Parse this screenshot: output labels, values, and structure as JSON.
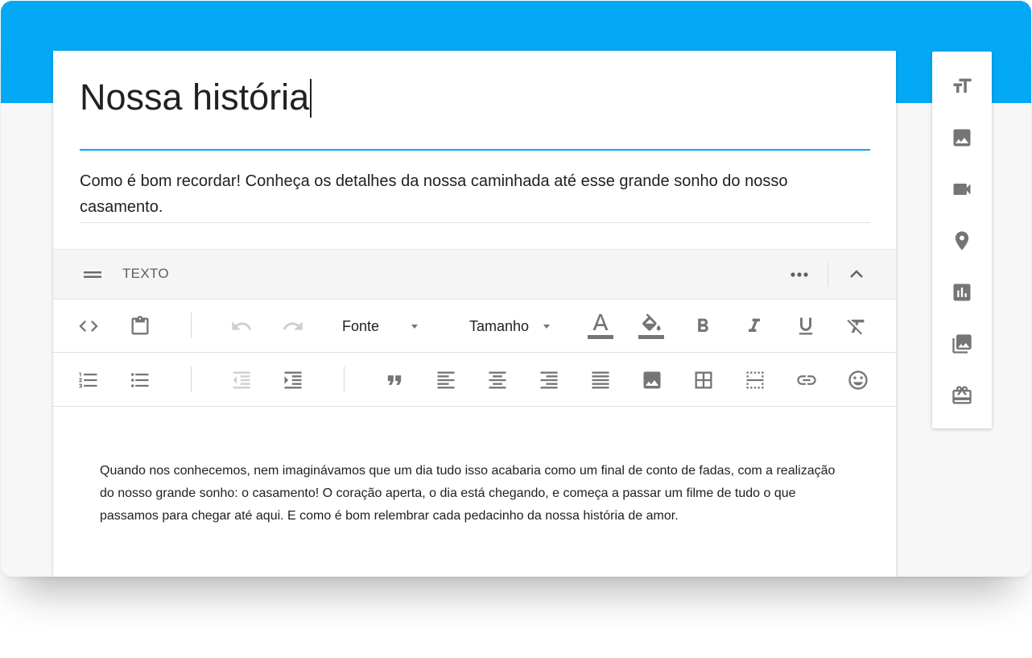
{
  "post": {
    "title": "Nossa história",
    "subtitle": "Como é bom recordar! Conheça os detalhes da nossa caminhada até esse grande sonho do nosso casamento."
  },
  "section": {
    "label": "TEXTO"
  },
  "toolbar": {
    "font_label": "Fonte",
    "size_label": "Tamanho"
  },
  "content": {
    "body": "Quando nos conhecemos, nem imaginávamos que um dia tudo isso acabaria como um final de conto de fadas, com a realização do nosso grande sonho: o casamento! O coração aperta, o dia está chegando, e começa a passar um filme de tudo o que passamos para chegar até aqui. E como é bom relembrar cada pedacinho da nossa história de amor."
  },
  "side_panel": {
    "items": [
      "text-size-icon",
      "image-icon",
      "video-icon",
      "location-pin-icon",
      "chart-icon",
      "gallery-icon",
      "gift-icon"
    ]
  },
  "colors": {
    "accent": "#03a9f4",
    "icon": "#757575",
    "icon_disabled": "#cfcfcf",
    "text": "#212121"
  }
}
